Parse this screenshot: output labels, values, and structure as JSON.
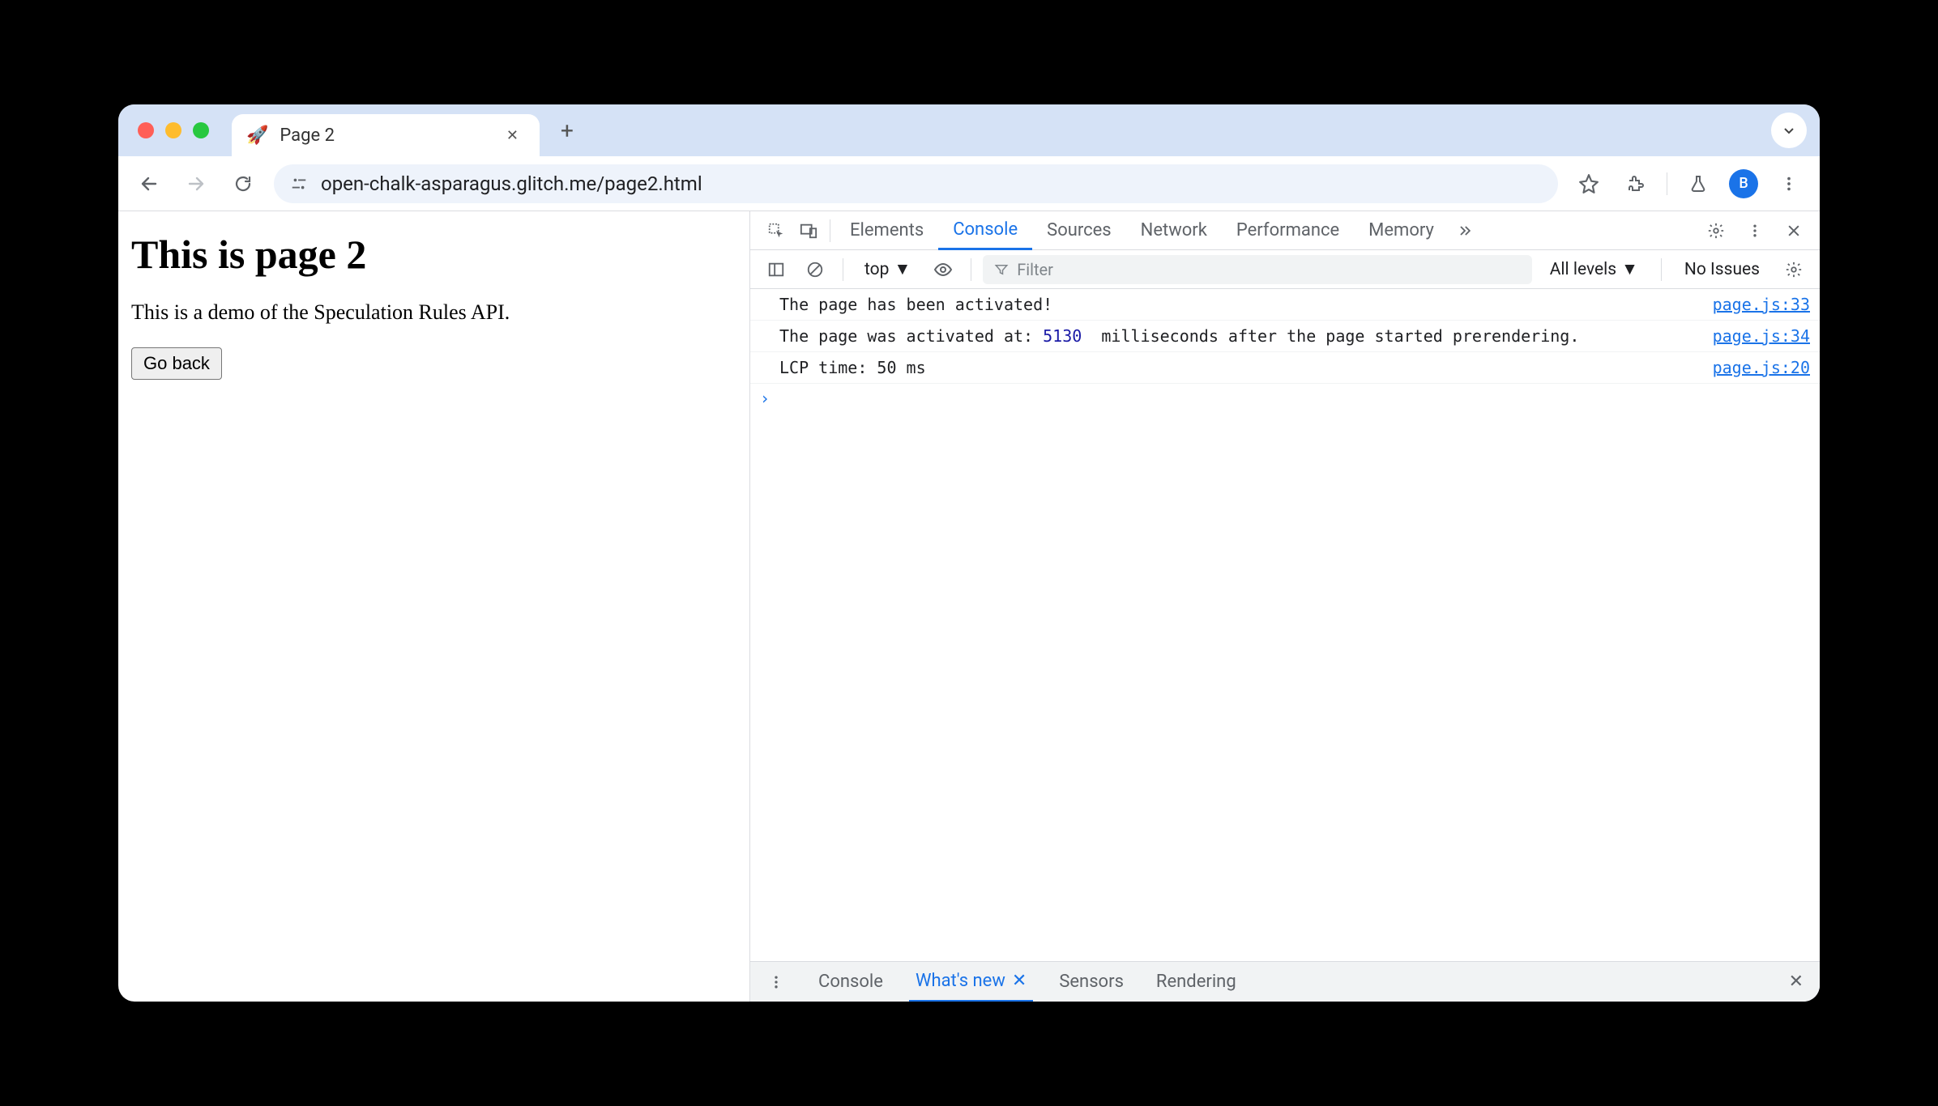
{
  "tab": {
    "favicon": "🚀",
    "title": "Page 2"
  },
  "url": "open-chalk-asparagus.glitch.me/page2.html",
  "avatar_letter": "B",
  "page": {
    "heading": "This is page 2",
    "paragraph": "This is a demo of the Speculation Rules API.",
    "button": "Go back"
  },
  "devtools": {
    "tabs": [
      "Elements",
      "Console",
      "Sources",
      "Network",
      "Performance",
      "Memory"
    ],
    "active_tab": "Console",
    "context": "top",
    "filter_placeholder": "Filter",
    "levels_label": "All levels",
    "issues_label": "No Issues"
  },
  "console_rows": [
    {
      "msg_pre": "The page has been activated!",
      "num": "",
      "msg_post": "",
      "link": "page.js:33"
    },
    {
      "msg_pre": "The page was activated at: ",
      "num": "5130",
      "msg_post": "  milliseconds after the page started prerendering.",
      "link": "page.js:34"
    },
    {
      "msg_pre": "LCP time: 50 ms",
      "num": "",
      "msg_post": "",
      "link": "page.js:20"
    }
  ],
  "drawer": {
    "tabs": [
      "Console",
      "What's new",
      "Sensors",
      "Rendering"
    ],
    "active": "What's new"
  }
}
